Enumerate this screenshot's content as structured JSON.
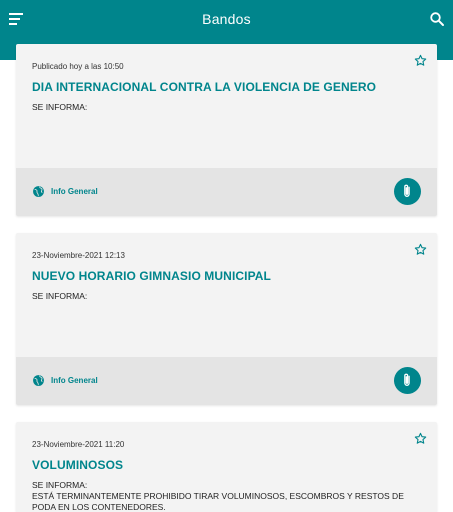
{
  "appbar": {
    "title": "Bandos",
    "menu_icon": "menu-icon",
    "search_icon": "search-icon"
  },
  "colors": {
    "primary": "#00858c",
    "card_bg": "#f3f3f3",
    "footer_bg": "#e4e4e4"
  },
  "cards": [
    {
      "date": "Publicado hoy a las 10:50",
      "title": "DIA INTERNACIONAL CONTRA LA VIOLENCIA DE GENERO",
      "body": [
        "SE INFORMA:"
      ],
      "category": "Info General"
    },
    {
      "date": "23-Noviembre-2021 12:13",
      "title": "NUEVO HORARIO GIMNASIO MUNICIPAL",
      "body": [
        "SE INFORMA:"
      ],
      "category": "Info General"
    },
    {
      "date": "23-Noviembre-2021 11:20",
      "title": "VOLUMINOSOS",
      "body": [
        "SE INFORMA:",
        "ESTÁ TERMINANTEMENTE PROHIBIDO TIRAR VOLUMINOSOS, ESCOMBROS Y RESTOS DE PODA EN LOS CONTENEDORES."
      ],
      "category": ""
    }
  ]
}
